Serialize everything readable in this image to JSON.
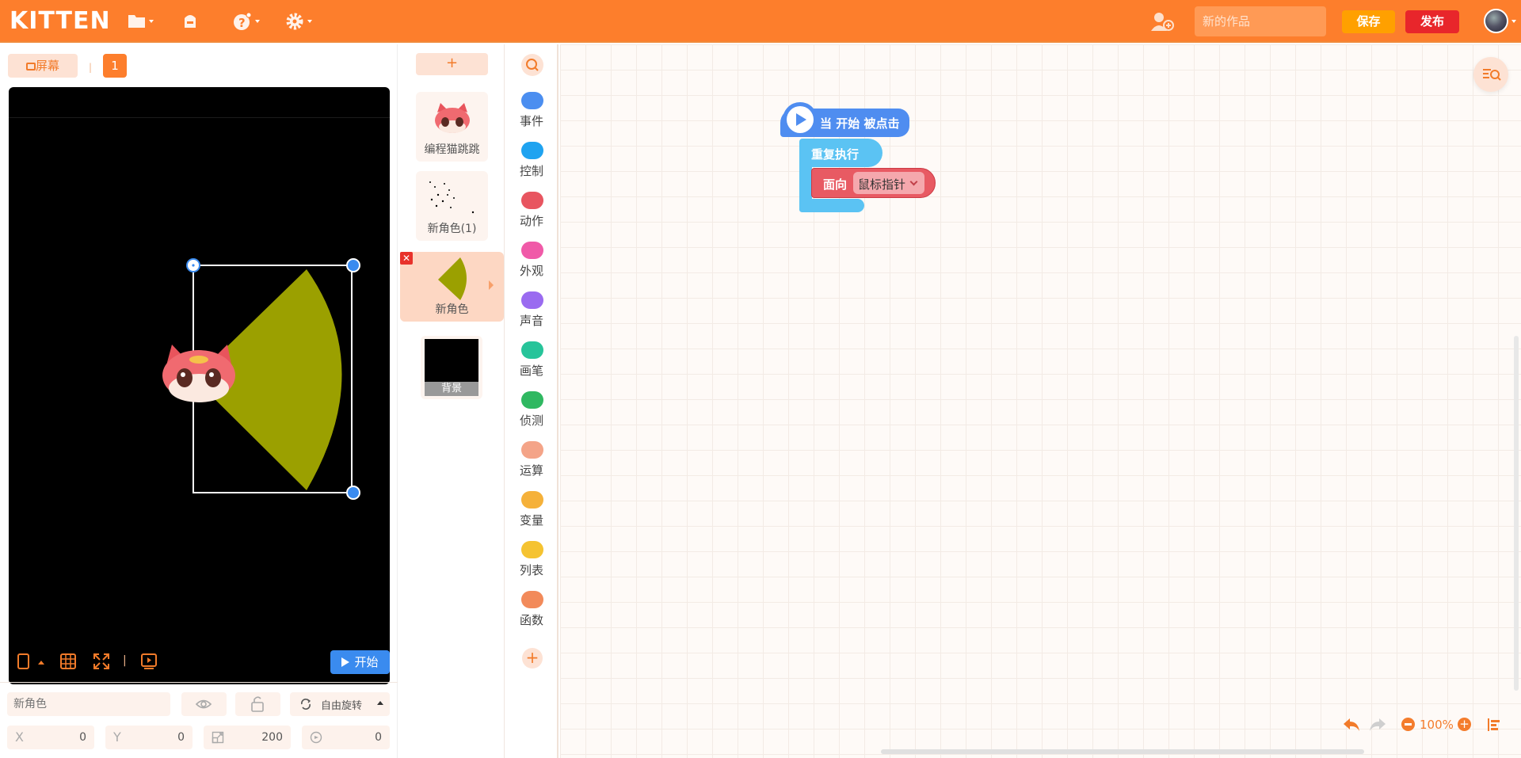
{
  "app": {
    "logo": "KITTEN"
  },
  "topbar": {
    "title_placeholder": "新的作品",
    "save_label": "保存",
    "publish_label": "发布"
  },
  "stage": {
    "screen_label": "屏幕",
    "screen_number": "1",
    "start_label": "开始",
    "sprite_name_placeholder": "新角色",
    "rotation_label": "自由旋转",
    "x_label": "X",
    "y_label": "Y",
    "x_value": "0",
    "y_value": "0",
    "size_value": "200",
    "direction_value": "0"
  },
  "sprites": {
    "add_label": "+",
    "items": [
      {
        "name": "编程猫跳跳"
      },
      {
        "name": "新角色(1)"
      },
      {
        "name": "新角色"
      }
    ],
    "background_label": "背景"
  },
  "palette": {
    "categories": [
      {
        "label": "事件",
        "color": "#4b8ef0"
      },
      {
        "label": "控制",
        "color": "#1fa3f0"
      },
      {
        "label": "动作",
        "color": "#e85560"
      },
      {
        "label": "外观",
        "color": "#f05aa8"
      },
      {
        "label": "声音",
        "color": "#9a6bf0"
      },
      {
        "label": "画笔",
        "color": "#27c49a"
      },
      {
        "label": "侦测",
        "color": "#2fb861"
      },
      {
        "label": "运算",
        "color": "#f4a488"
      },
      {
        "label": "变量",
        "color": "#f5b13a"
      },
      {
        "label": "列表",
        "color": "#f5c331"
      },
      {
        "label": "函数",
        "color": "#f28a5a"
      }
    ],
    "add_label": "+"
  },
  "blocks": {
    "hat_label": "当 开始 被点击",
    "repeat_label": "重复执行",
    "face_label": "面向",
    "face_target": "鼠标指针"
  },
  "zoom": {
    "level": "100%"
  },
  "colors": {
    "brand": "#fd7e2c",
    "save": "#ffa000",
    "publish": "#e8262b",
    "start": "#3a8bef"
  }
}
